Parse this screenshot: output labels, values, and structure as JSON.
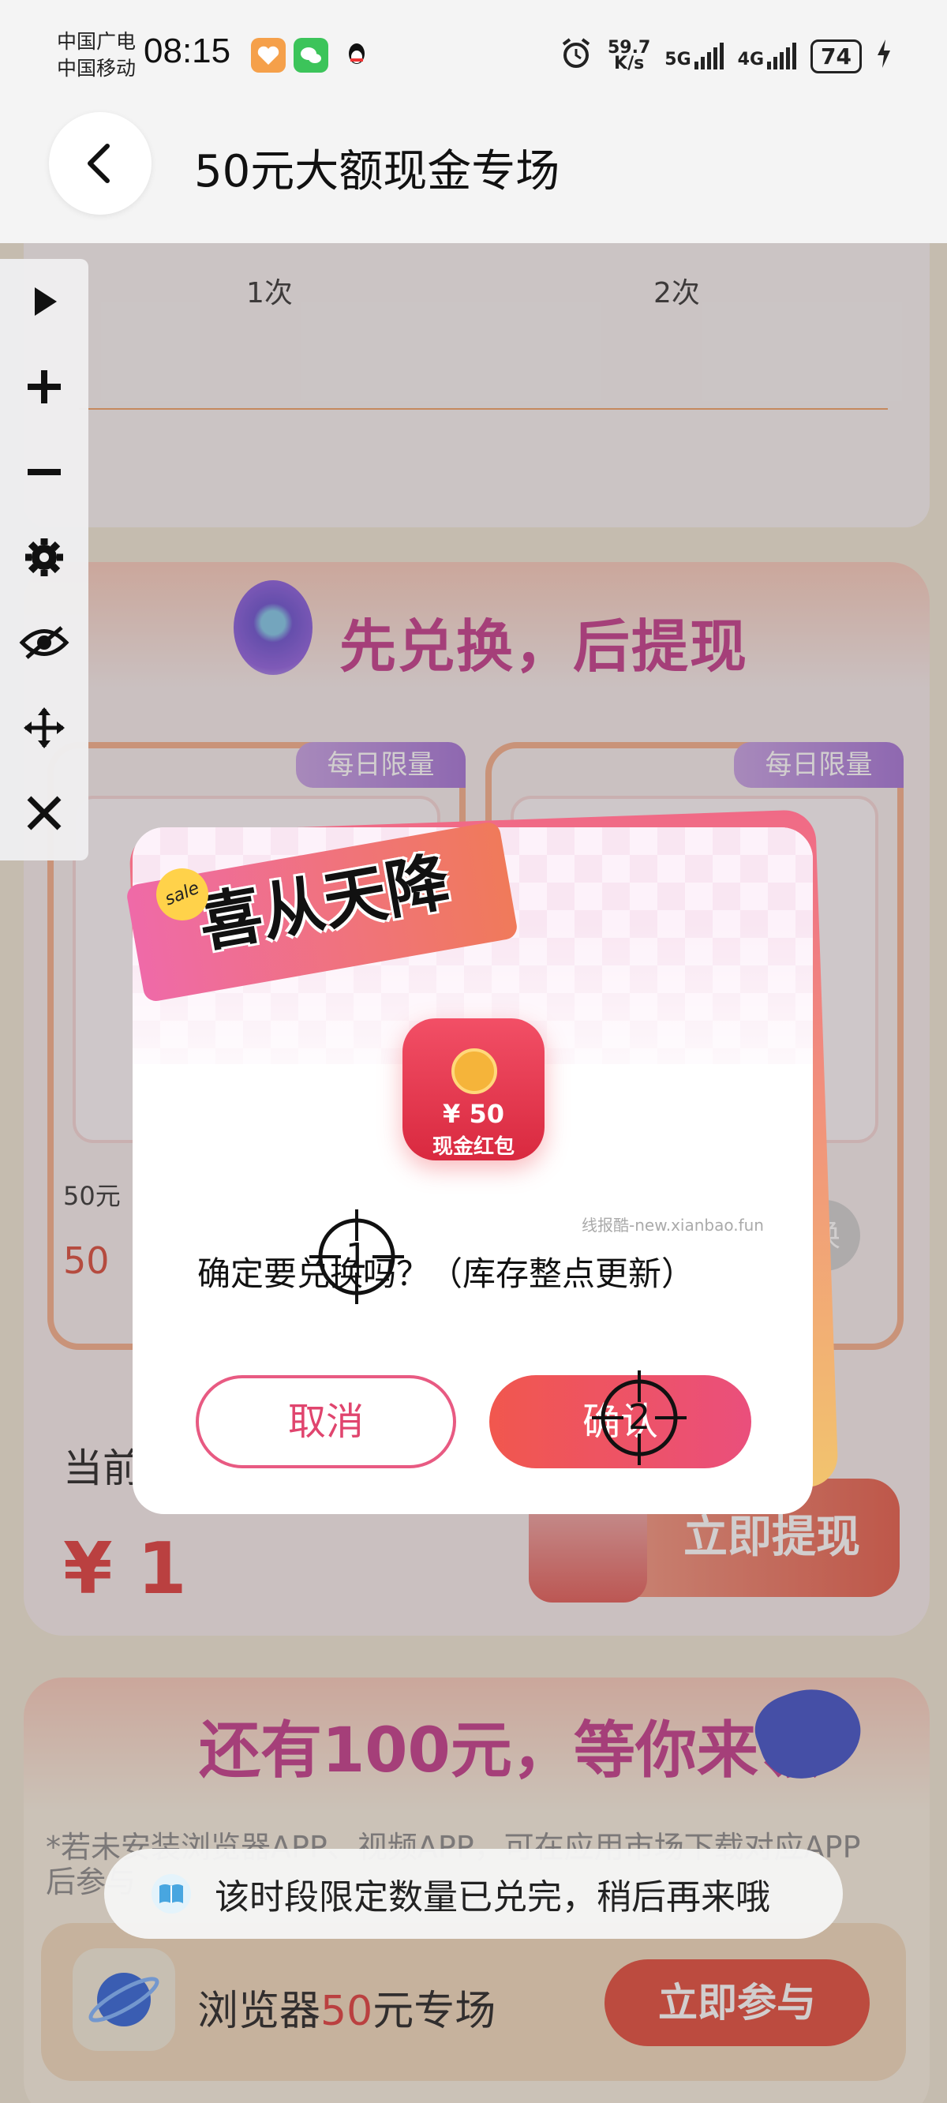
{
  "status_bar": {
    "carrier_1": "中国广电",
    "carrier_2": "中国移动",
    "time": "08:15",
    "net_speed_value": "59.7",
    "net_speed_unit": "K/s",
    "signal_1": "5G",
    "signal_2": "4G",
    "battery": "74"
  },
  "header": {
    "title": "50元大额现金专场"
  },
  "background": {
    "times": [
      "1次",
      "2次"
    ],
    "exchange_title": "先兑换，后提现",
    "limit_tag": "每日限量",
    "card_label": "50元",
    "card_price": "50",
    "card_exchange_btn": "换",
    "current_label": "当前",
    "balance": "¥ 1",
    "withdraw_button": "立即提现",
    "more_title": "还有100元，等你来领",
    "note": "*若未安装浏览器APP、视频APP，可在应用市场下载对应APP后参与",
    "browser": {
      "label_prefix": "浏览器",
      "label_amount": "50",
      "label_suffix": "元专场",
      "button": "立即参与"
    }
  },
  "dialog": {
    "sale_tag": "sale",
    "banner": "喜从天降",
    "redpack_amount": "¥ 50",
    "redpack_name": "现金红包",
    "watermark": "线报酷-new.xianbao.fun",
    "question": "确定要兑换吗？（库存整点更新）",
    "cancel": "取消",
    "confirm": "确认"
  },
  "markers": [
    "1",
    "2"
  ],
  "toast": {
    "text": "该时段限定数量已兑完，稍后再来哦"
  },
  "tools": [
    "play-icon",
    "plus-icon",
    "minus-icon",
    "gear-icon",
    "eye-off-icon",
    "move-icon",
    "close-icon"
  ],
  "colors": {
    "accent_red": "#e03b3b",
    "pink": "#e85a82",
    "title_magenta": "#c23a8a"
  }
}
